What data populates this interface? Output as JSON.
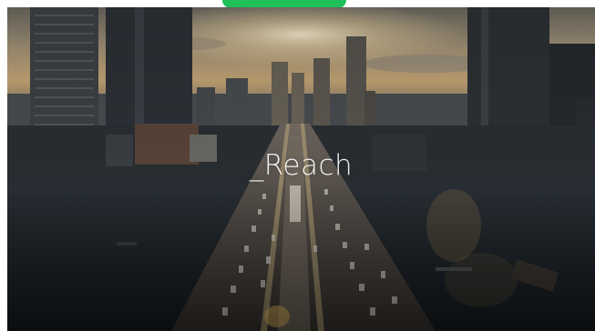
{
  "overlay": {
    "title": "_Reach"
  },
  "scene": {
    "description_icon": "aerial-city-bridge-photo",
    "accent_tab_color": "#1fbf5a"
  }
}
